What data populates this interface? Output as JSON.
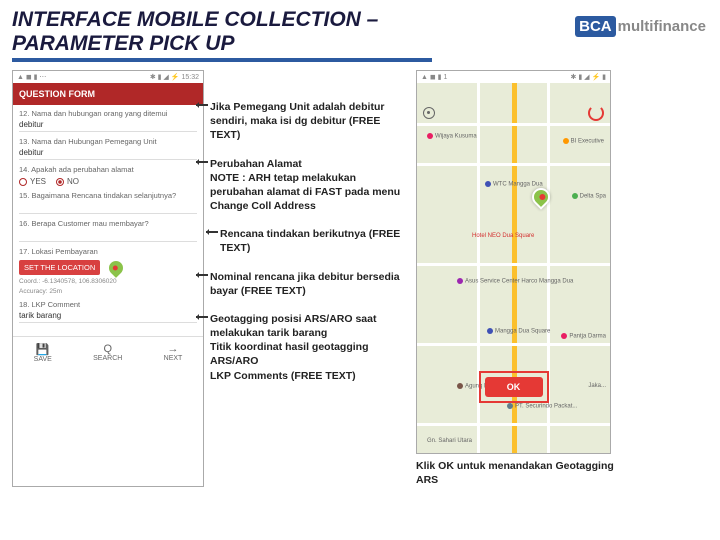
{
  "title": "INTERFACE MOBILE COLLECTION – PARAMETER PICK UP",
  "logo": {
    "brand": "BCA",
    "suffix": "multifinance"
  },
  "phone1": {
    "time": "15:32",
    "appbar": "QUESTION FORM",
    "q12": {
      "label": "12. Nama dan hubungan orang yang ditemui",
      "val": "debitur"
    },
    "q13": {
      "label": "13. Nama dan Hubungan Pemegang Unit",
      "val": "debitur"
    },
    "q14": {
      "label": "14. Apakah ada perubahan alamat",
      "yes": "YES",
      "no": "NO"
    },
    "q15": {
      "label": "15. Bagaimana Rencana tindakan selanjutnya?"
    },
    "q16": {
      "label": "16. Berapa Customer mau membayar?"
    },
    "q17": {
      "label": "17. Lokasi Pembayaran",
      "btn": "SET THE LOCATION",
      "coord": "Coord.: -6.1340578, 106.8306020",
      "acc": "Accuracy: 25m"
    },
    "q18": {
      "label": "18. LKP Comment",
      "val": "tarik barang"
    },
    "bar": {
      "save": "SAVE",
      "search": "SEARCH",
      "next": "NEXT"
    }
  },
  "notes": {
    "n1": "Jika Pemegang Unit adalah debitur sendiri, maka isi dg debitur (FREE TEXT)",
    "n2": "Perubahan Alamat\nNOTE : ARH tetap melakukan perubahan alamat di FAST pada menu Change Coll Address",
    "n3": "Rencana tindakan berikutnya (FREE TEXT)",
    "n4": "Nominal rencana jika debitur bersedia bayar (FREE TEXT)",
    "n5": "Geotagging posisi ARS/ARO saat melakukan tarik barang\nTitik koordinat hasil geotagging ARS/ARO\nLKP Comments (FREE TEXT)"
  },
  "phone2": {
    "time": "1",
    "ok": "OK",
    "poi": {
      "p1": "Wijaya Kusuma",
      "p2": "BI Executive",
      "p3": "WTC Mangga Dua",
      "p4": "Delta Spa",
      "p5": "Hotel NEO Dua Square",
      "p6": "Asus Service Center Harco Mangga Dua",
      "p7": "Mangga Dua Square",
      "p8": "Pantja Darma",
      "p9": "Agung Podomoro",
      "p10": "Gn. Sahari Utara",
      "p11": "PT. Securindo Packat...",
      "p12": "Jaka..."
    }
  },
  "note_ok": "Klik OK untuk menandakan Geotagging ARS"
}
